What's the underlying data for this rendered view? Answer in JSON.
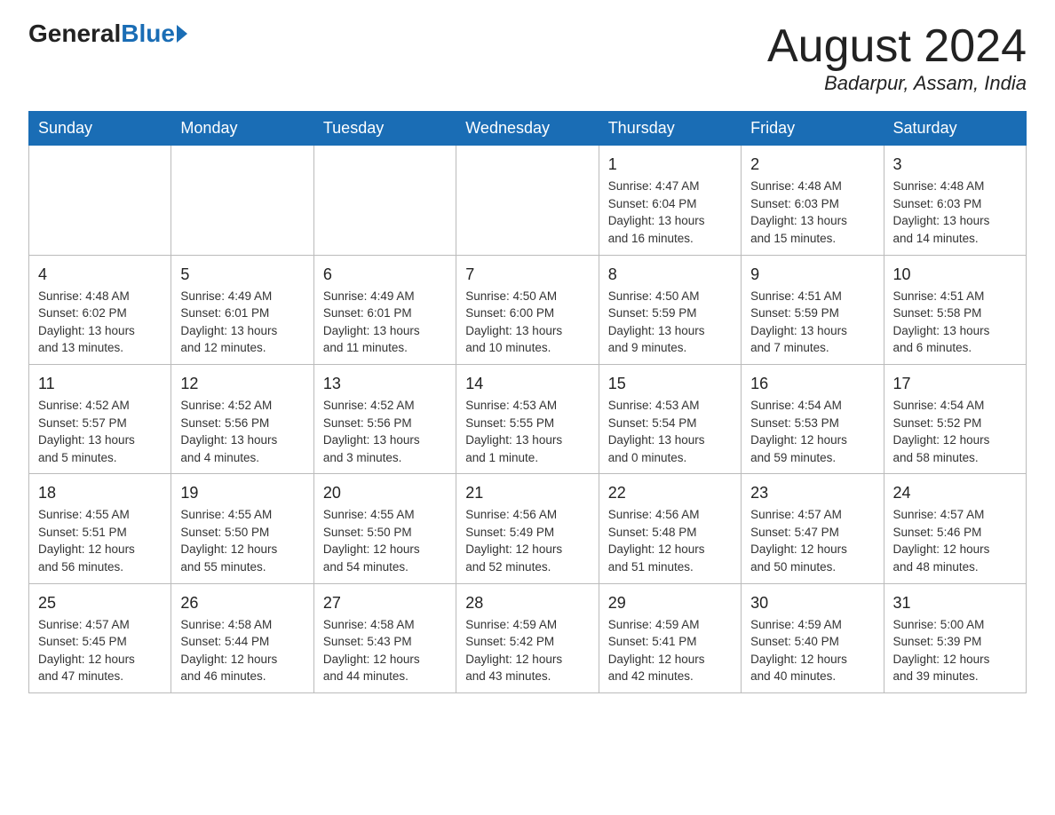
{
  "header": {
    "logo_general": "General",
    "logo_blue": "Blue",
    "month_year": "August 2024",
    "location": "Badarpur, Assam, India"
  },
  "weekdays": [
    "Sunday",
    "Monday",
    "Tuesday",
    "Wednesday",
    "Thursday",
    "Friday",
    "Saturday"
  ],
  "weeks": [
    [
      {
        "day": "",
        "info": ""
      },
      {
        "day": "",
        "info": ""
      },
      {
        "day": "",
        "info": ""
      },
      {
        "day": "",
        "info": ""
      },
      {
        "day": "1",
        "info": "Sunrise: 4:47 AM\nSunset: 6:04 PM\nDaylight: 13 hours\nand 16 minutes."
      },
      {
        "day": "2",
        "info": "Sunrise: 4:48 AM\nSunset: 6:03 PM\nDaylight: 13 hours\nand 15 minutes."
      },
      {
        "day": "3",
        "info": "Sunrise: 4:48 AM\nSunset: 6:03 PM\nDaylight: 13 hours\nand 14 minutes."
      }
    ],
    [
      {
        "day": "4",
        "info": "Sunrise: 4:48 AM\nSunset: 6:02 PM\nDaylight: 13 hours\nand 13 minutes."
      },
      {
        "day": "5",
        "info": "Sunrise: 4:49 AM\nSunset: 6:01 PM\nDaylight: 13 hours\nand 12 minutes."
      },
      {
        "day": "6",
        "info": "Sunrise: 4:49 AM\nSunset: 6:01 PM\nDaylight: 13 hours\nand 11 minutes."
      },
      {
        "day": "7",
        "info": "Sunrise: 4:50 AM\nSunset: 6:00 PM\nDaylight: 13 hours\nand 10 minutes."
      },
      {
        "day": "8",
        "info": "Sunrise: 4:50 AM\nSunset: 5:59 PM\nDaylight: 13 hours\nand 9 minutes."
      },
      {
        "day": "9",
        "info": "Sunrise: 4:51 AM\nSunset: 5:59 PM\nDaylight: 13 hours\nand 7 minutes."
      },
      {
        "day": "10",
        "info": "Sunrise: 4:51 AM\nSunset: 5:58 PM\nDaylight: 13 hours\nand 6 minutes."
      }
    ],
    [
      {
        "day": "11",
        "info": "Sunrise: 4:52 AM\nSunset: 5:57 PM\nDaylight: 13 hours\nand 5 minutes."
      },
      {
        "day": "12",
        "info": "Sunrise: 4:52 AM\nSunset: 5:56 PM\nDaylight: 13 hours\nand 4 minutes."
      },
      {
        "day": "13",
        "info": "Sunrise: 4:52 AM\nSunset: 5:56 PM\nDaylight: 13 hours\nand 3 minutes."
      },
      {
        "day": "14",
        "info": "Sunrise: 4:53 AM\nSunset: 5:55 PM\nDaylight: 13 hours\nand 1 minute."
      },
      {
        "day": "15",
        "info": "Sunrise: 4:53 AM\nSunset: 5:54 PM\nDaylight: 13 hours\nand 0 minutes."
      },
      {
        "day": "16",
        "info": "Sunrise: 4:54 AM\nSunset: 5:53 PM\nDaylight: 12 hours\nand 59 minutes."
      },
      {
        "day": "17",
        "info": "Sunrise: 4:54 AM\nSunset: 5:52 PM\nDaylight: 12 hours\nand 58 minutes."
      }
    ],
    [
      {
        "day": "18",
        "info": "Sunrise: 4:55 AM\nSunset: 5:51 PM\nDaylight: 12 hours\nand 56 minutes."
      },
      {
        "day": "19",
        "info": "Sunrise: 4:55 AM\nSunset: 5:50 PM\nDaylight: 12 hours\nand 55 minutes."
      },
      {
        "day": "20",
        "info": "Sunrise: 4:55 AM\nSunset: 5:50 PM\nDaylight: 12 hours\nand 54 minutes."
      },
      {
        "day": "21",
        "info": "Sunrise: 4:56 AM\nSunset: 5:49 PM\nDaylight: 12 hours\nand 52 minutes."
      },
      {
        "day": "22",
        "info": "Sunrise: 4:56 AM\nSunset: 5:48 PM\nDaylight: 12 hours\nand 51 minutes."
      },
      {
        "day": "23",
        "info": "Sunrise: 4:57 AM\nSunset: 5:47 PM\nDaylight: 12 hours\nand 50 minutes."
      },
      {
        "day": "24",
        "info": "Sunrise: 4:57 AM\nSunset: 5:46 PM\nDaylight: 12 hours\nand 48 minutes."
      }
    ],
    [
      {
        "day": "25",
        "info": "Sunrise: 4:57 AM\nSunset: 5:45 PM\nDaylight: 12 hours\nand 47 minutes."
      },
      {
        "day": "26",
        "info": "Sunrise: 4:58 AM\nSunset: 5:44 PM\nDaylight: 12 hours\nand 46 minutes."
      },
      {
        "day": "27",
        "info": "Sunrise: 4:58 AM\nSunset: 5:43 PM\nDaylight: 12 hours\nand 44 minutes."
      },
      {
        "day": "28",
        "info": "Sunrise: 4:59 AM\nSunset: 5:42 PM\nDaylight: 12 hours\nand 43 minutes."
      },
      {
        "day": "29",
        "info": "Sunrise: 4:59 AM\nSunset: 5:41 PM\nDaylight: 12 hours\nand 42 minutes."
      },
      {
        "day": "30",
        "info": "Sunrise: 4:59 AM\nSunset: 5:40 PM\nDaylight: 12 hours\nand 40 minutes."
      },
      {
        "day": "31",
        "info": "Sunrise: 5:00 AM\nSunset: 5:39 PM\nDaylight: 12 hours\nand 39 minutes."
      }
    ]
  ]
}
